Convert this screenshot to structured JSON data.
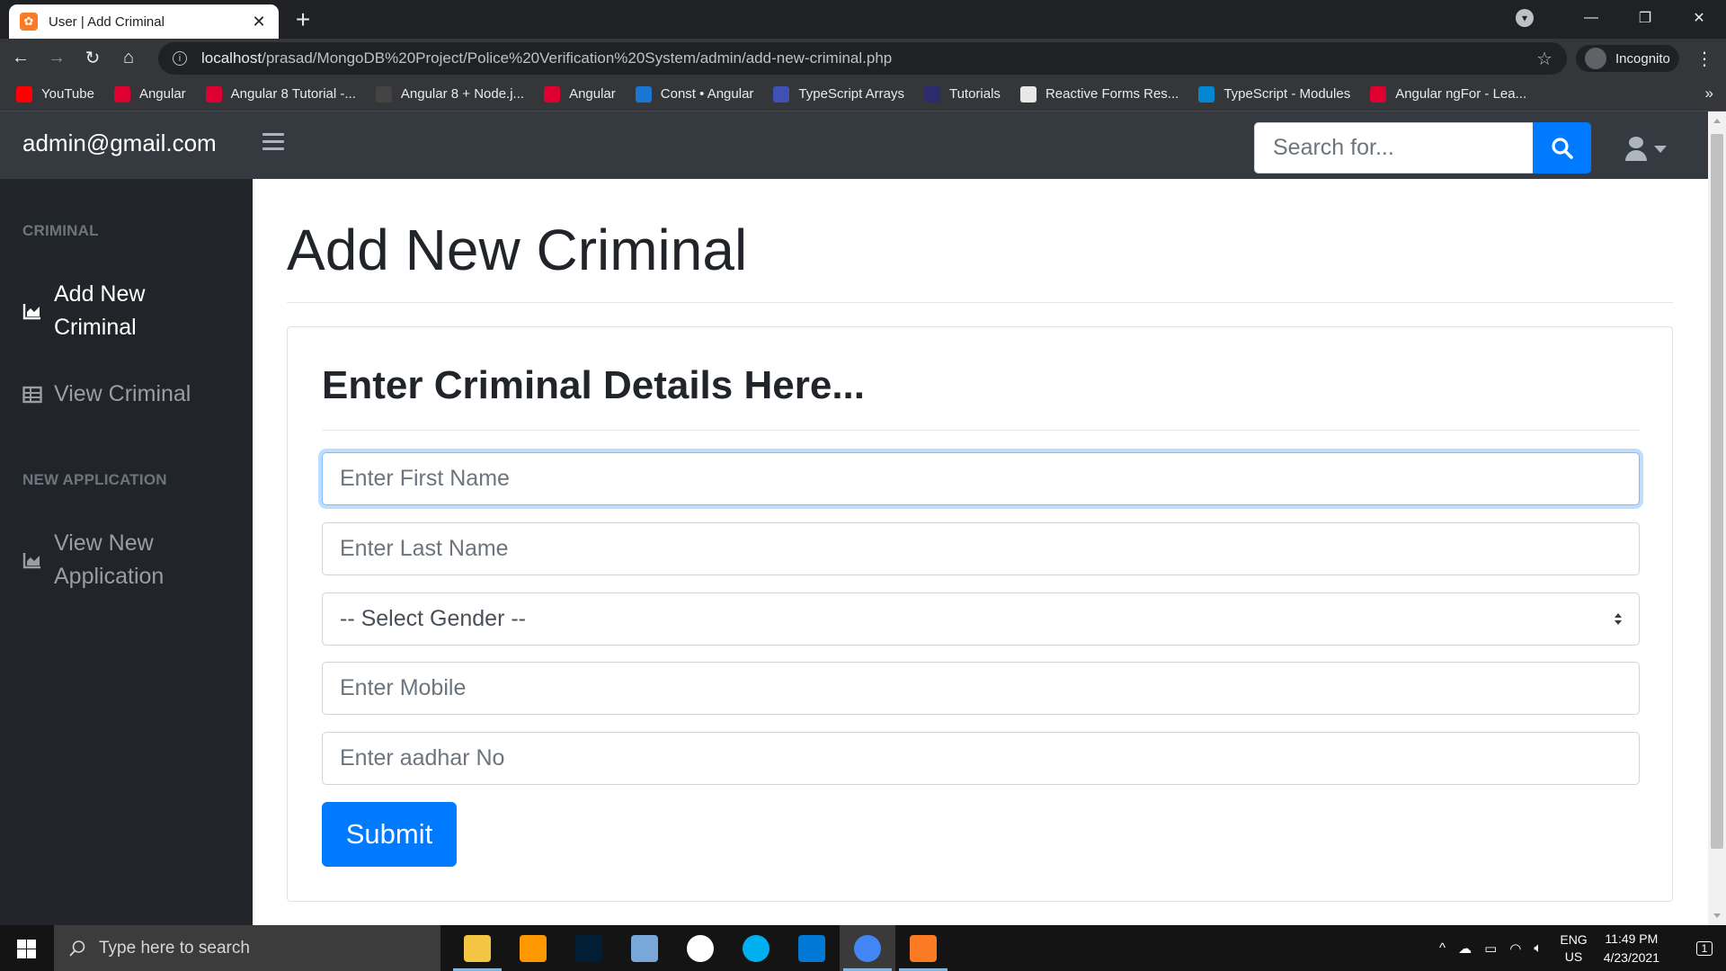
{
  "browser": {
    "tab_title": "User | Add Criminal",
    "url_host": "localhost",
    "url_path": "/prasad/MongoDB%20Project/Police%20Verification%20System/admin/add-new-criminal.php",
    "incognito_label": "Incognito",
    "bookmarks": [
      {
        "label": "YouTube",
        "icon": "youtube-icon",
        "color": "#ff0000"
      },
      {
        "label": "Angular",
        "icon": "angular-icon",
        "color": "#dd0031"
      },
      {
        "label": "Angular 8 Tutorial -...",
        "icon": "angular-tutorial-icon",
        "color": "#dd0031"
      },
      {
        "label": "Angular 8 + Node.j...",
        "icon": "page-icon",
        "color": "#444444"
      },
      {
        "label": "Angular",
        "icon": "angular-icon",
        "color": "#dd0031"
      },
      {
        "label": "Const • Angular",
        "icon": "const-icon",
        "color": "#1976d2"
      },
      {
        "label": "TypeScript Arrays",
        "icon": "ts-arrays-icon",
        "color": "#3f51b5"
      },
      {
        "label": "Tutorials",
        "icon": "tutorials-icon",
        "color": "#2c2c6c"
      },
      {
        "label": "Reactive Forms Res...",
        "icon": "reactive-forms-icon",
        "color": "#e8e8e8"
      },
      {
        "label": "TypeScript - Modules",
        "icon": "typescript-icon",
        "color": "#0288d1"
      },
      {
        "label": "Angular ngFor - Lea...",
        "icon": "angular-icon",
        "color": "#dd0031"
      }
    ]
  },
  "app": {
    "brand": "admin@gmail.com",
    "search_placeholder": "Search for...",
    "sidebar": {
      "sections": [
        {
          "heading": "CRIMINAL",
          "items": [
            {
              "label_line1": "Add New",
              "label_line2": "Criminal",
              "icon": "area-chart-icon"
            },
            {
              "label": "View Criminal",
              "icon": "table-icon"
            }
          ]
        },
        {
          "heading": "NEW APPLICATION",
          "items": [
            {
              "label_line1": "View New",
              "label_line2": "Application",
              "icon": "area-chart-icon"
            }
          ]
        }
      ]
    },
    "page_title": "Add New Criminal",
    "card_title": "Enter Criminal Details Here...",
    "form": {
      "first_name_placeholder": "Enter First Name",
      "last_name_placeholder": "Enter Last Name",
      "gender_selected": "-- Select Gender --",
      "mobile_placeholder": "Enter Mobile",
      "aadhar_placeholder": "Enter aadhar No",
      "submit_label": "Submit"
    },
    "colors": {
      "primary": "#007bff",
      "nav_bg": "#343a40",
      "sidebar_bg": "#212529"
    }
  },
  "taskbar": {
    "search_placeholder": "Type here to search",
    "apps": [
      {
        "name": "file-explorer-icon",
        "color": "#f4c542"
      },
      {
        "name": "sublime-text-icon",
        "color": "#ff9800"
      },
      {
        "name": "photoshop-icon",
        "color": "#001e36"
      },
      {
        "name": "paint-icon",
        "color": "#7aa7d9"
      },
      {
        "name": "mongodb-compass-icon",
        "color": "#ffffff"
      },
      {
        "name": "skype-icon",
        "color": "#00aff0"
      },
      {
        "name": "vscode-icon",
        "color": "#0078d4"
      },
      {
        "name": "chrome-icon",
        "color": "#4285f4"
      },
      {
        "name": "xampp-icon",
        "color": "#fb7a24"
      }
    ],
    "lang_line1": "ENG",
    "lang_line2": "US",
    "time": "11:49 PM",
    "date": "4/23/2021",
    "notification_count": "1"
  }
}
